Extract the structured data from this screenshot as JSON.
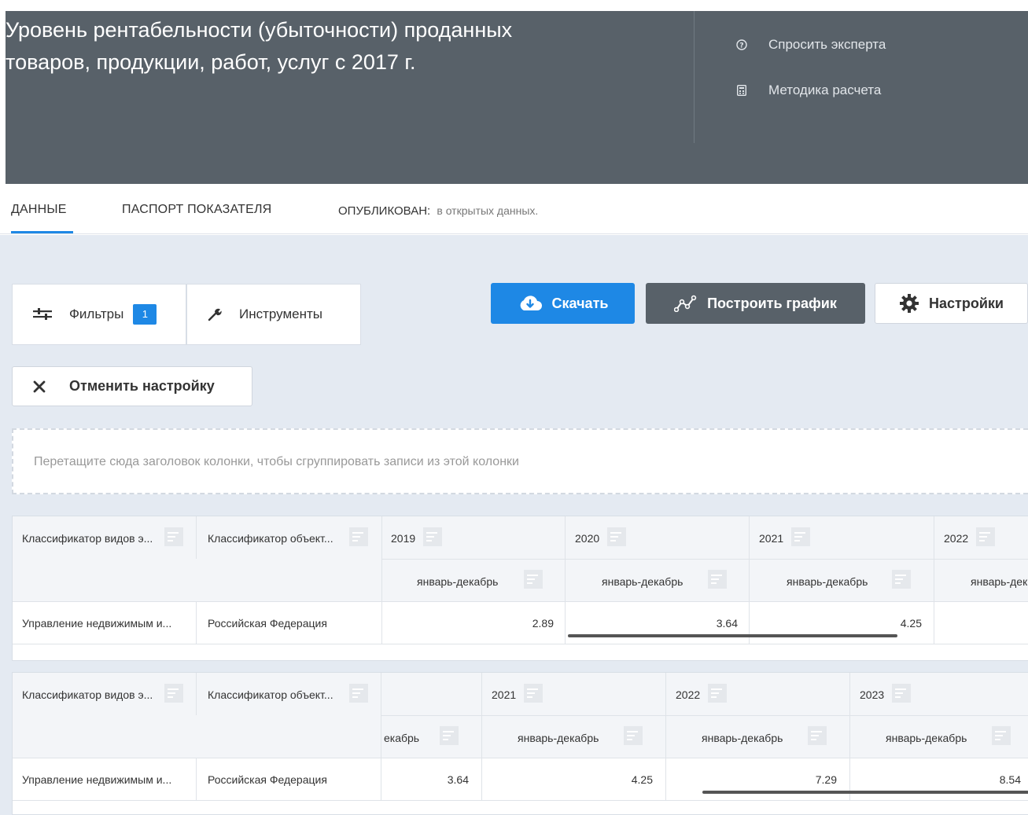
{
  "header": {
    "title_line1": "Уровень рентабельности (убыточности) проданных",
    "title_line2": "товаров, продукции, работ, услуг с 2017 г.",
    "ask_expert": "Спросить эксперта",
    "method": "Методика расчета",
    "bg_color": "#586169"
  },
  "tabs": {
    "data": "ДАННЫЕ",
    "passport": "ПАСПОРТ ПОКАЗАТЕЛЯ",
    "published_label": "ОПУБЛИКОВАН:",
    "published_value": "в открытых данных."
  },
  "toolbar": {
    "filters": "Фильтры",
    "filters_count": "1",
    "tools": "Инструменты",
    "download": "Скачать",
    "build_chart": "Построить график",
    "settings": "Настройки",
    "reset": "Отменить настройку",
    "accent_color": "#1e88e5"
  },
  "dropzone": {
    "text": "Перетащите сюда заголовок колонки, чтобы сгруппировать записи из этой колонки"
  },
  "grid1": {
    "col1_header": "Классификатор видов э...",
    "col2_header": "Классификатор объект...",
    "years": [
      "2019",
      "2020",
      "2021",
      "2022"
    ],
    "periods": [
      "январь-декабрь",
      "январь-декабрь",
      "январь-декабрь",
      "январь-дек"
    ],
    "row": {
      "col1": "Управление недвижимым и...",
      "col2": "Российская Федерация",
      "values": [
        "2.89",
        "3.64",
        "4.25",
        ""
      ]
    }
  },
  "grid2": {
    "col1_header": "Классификатор видов э...",
    "col2_header": "Классификатор объект...",
    "years": [
      "2021",
      "2022",
      "2023"
    ],
    "periods": [
      "екабрь",
      "январь-декабрь",
      "январь-декабрь",
      "январь-декабрь"
    ],
    "row": {
      "col1": "Управление недвижимым и...",
      "col2": "Российская Федерация",
      "values": [
        "3.64",
        "4.25",
        "7.29",
        "8.54"
      ]
    }
  }
}
